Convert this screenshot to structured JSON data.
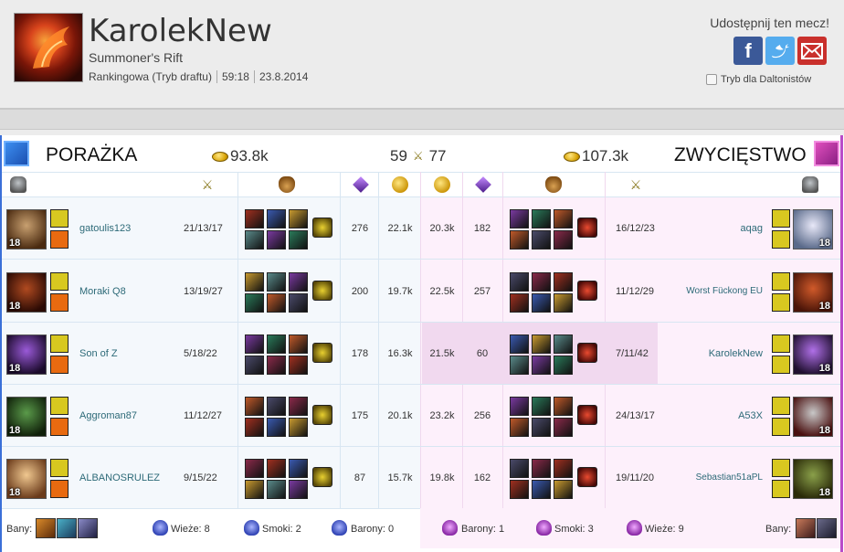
{
  "header": {
    "summoner_name": "KarolekNew",
    "map": "Summoner's Rift",
    "queue": "Rankingowa (Tryb draftu)",
    "duration": "59:18",
    "date": "23.8.2014",
    "share_label": "Udostępnij ten mecz!",
    "colorblind_label": "Tryb dla Daltonistów",
    "share_icons": [
      "facebook-icon",
      "twitter-icon",
      "mail-icon"
    ]
  },
  "summary": {
    "blue_result": "PORAŻKA",
    "red_result": "ZWYCIĘSTWO",
    "blue_gold": "93.8k",
    "red_gold": "107.3k",
    "blue_kills": "59",
    "red_kills": "77"
  },
  "blue_team": [
    {
      "name": "gatoulis123",
      "kda": "21/13/17",
      "level": "18",
      "cs": "276",
      "gold": "22.1k"
    },
    {
      "name": "Moraki Q8",
      "kda": "13/19/27",
      "level": "18",
      "cs": "200",
      "gold": "19.7k"
    },
    {
      "name": "Son of Z",
      "kda": "5/18/22",
      "level": "18",
      "cs": "178",
      "gold": "16.3k"
    },
    {
      "name": "Aggroman87",
      "kda": "11/12/27",
      "level": "18",
      "cs": "175",
      "gold": "20.1k"
    },
    {
      "name": "ALBANOSRULEZ",
      "kda": "9/15/22",
      "level": "18",
      "cs": "87",
      "gold": "15.7k"
    }
  ],
  "red_team": [
    {
      "name": "aqag",
      "kda": "16/12/23",
      "level": "18",
      "cs": "182",
      "gold": "20.3k"
    },
    {
      "name": "Worst Fückong EU",
      "kda": "11/12/29",
      "level": "18",
      "cs": "257",
      "gold": "22.5k"
    },
    {
      "name": "KarolekNew",
      "kda": "7/11/42",
      "level": "18",
      "cs": "60",
      "gold": "21.5k"
    },
    {
      "name": "A53X",
      "kda": "24/13/17",
      "level": "18",
      "cs": "256",
      "gold": "23.2k"
    },
    {
      "name": "Sebastian51aPL",
      "kda": "19/11/20",
      "level": "18",
      "cs": "162",
      "gold": "19.8k"
    }
  ],
  "footer": {
    "bans_label": "Bany:",
    "blue_towers": "Wieże: 8",
    "blue_dragons": "Smoki: 2",
    "blue_barons": "Barony: 0",
    "red_barons": "Barony: 1",
    "red_dragons": "Smoki: 3",
    "red_towers": "Wieże: 9"
  },
  "colors": {
    "blue_accent": "#3a6fd8",
    "red_accent": "#b94bc9",
    "name_link": "#2d6a78"
  }
}
